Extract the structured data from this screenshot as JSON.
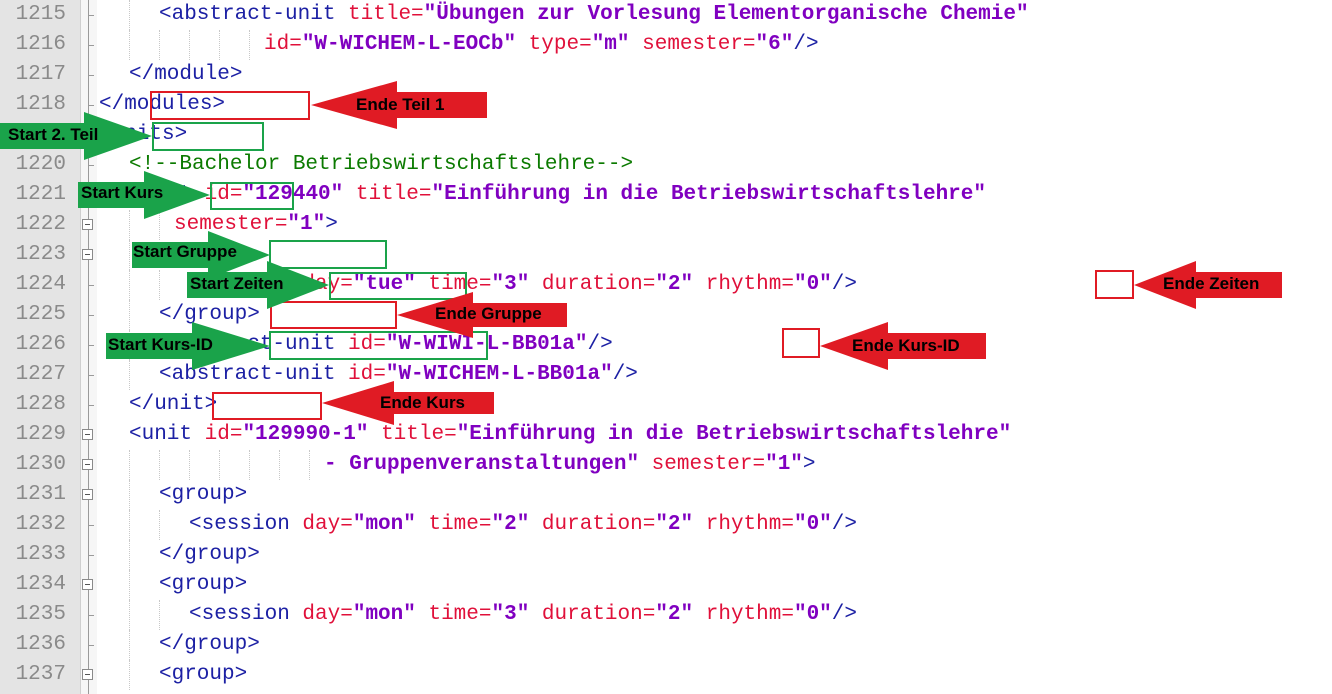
{
  "editor": {
    "lines": [
      {
        "no": "1215",
        "fold": "tick",
        "indent": 4,
        "parts": [
          [
            "t",
            "<abstract-unit "
          ],
          [
            "a",
            "title="
          ],
          [
            "v",
            "\"Übungen zur Vorlesung Elementorganische Chemie\""
          ]
        ]
      },
      {
        "no": "1216",
        "fold": "tick",
        "indent": 11,
        "parts": [
          [
            "a",
            "id="
          ],
          [
            "v",
            "\"W-WICHEM-L-EOCb\""
          ],
          [
            "t",
            " "
          ],
          [
            "a",
            "type="
          ],
          [
            "v",
            "\"m\""
          ],
          [
            "t",
            " "
          ],
          [
            "a",
            "semester="
          ],
          [
            "v",
            "\"6\""
          ],
          [
            "t",
            "/>"
          ]
        ]
      },
      {
        "no": "1217",
        "fold": "tick",
        "indent": 2,
        "parts": [
          [
            "t",
            "</module>"
          ]
        ]
      },
      {
        "no": "1218",
        "fold": "tick",
        "indent": 0,
        "parts": [
          [
            "t",
            "</modules>"
          ]
        ]
      },
      {
        "no": "1219",
        "fold": "box",
        "indent": 0,
        "parts": [
          [
            "t",
            "<units>"
          ]
        ]
      },
      {
        "no": "1220",
        "fold": "tick",
        "indent": 2,
        "parts": [
          [
            "c",
            "<!--Bachelor Betriebswirtschaftslehre-->"
          ]
        ]
      },
      {
        "no": "1221",
        "fold": "box",
        "indent": 2,
        "parts": [
          [
            "t",
            "<unit "
          ],
          [
            "a",
            "id="
          ],
          [
            "v",
            "\"129440\""
          ],
          [
            "t",
            " "
          ],
          [
            "a",
            "title="
          ],
          [
            "v",
            "\"Einführung in die Betriebswirtschaftslehre\""
          ]
        ]
      },
      {
        "no": "1222",
        "fold": "box",
        "indent": 5,
        "parts": [
          [
            "a",
            "semester="
          ],
          [
            "v",
            "\"1\""
          ],
          [
            "t",
            ">"
          ]
        ]
      },
      {
        "no": "1223",
        "fold": "box",
        "indent": 4,
        "parts": [
          [
            "t",
            "<group>"
          ]
        ]
      },
      {
        "no": "1224",
        "fold": "tick",
        "indent": 6,
        "parts": [
          [
            "t",
            "<session "
          ],
          [
            "a",
            "day="
          ],
          [
            "v",
            "\"tue\""
          ],
          [
            "t",
            " "
          ],
          [
            "a",
            "time="
          ],
          [
            "v",
            "\"3\""
          ],
          [
            "t",
            " "
          ],
          [
            "a",
            "duration="
          ],
          [
            "v",
            "\"2\""
          ],
          [
            "t",
            " "
          ],
          [
            "a",
            "rhythm="
          ],
          [
            "v",
            "\"0\""
          ],
          [
            "t",
            "/>"
          ]
        ]
      },
      {
        "no": "1225",
        "fold": "tick",
        "indent": 4,
        "parts": [
          [
            "t",
            "</group>"
          ]
        ]
      },
      {
        "no": "1226",
        "fold": "tick",
        "indent": 4,
        "parts": [
          [
            "t",
            "<abstract-unit "
          ],
          [
            "a",
            "id="
          ],
          [
            "v",
            "\"W-WIWI-L-BB01a\""
          ],
          [
            "t",
            "/>"
          ]
        ]
      },
      {
        "no": "1227",
        "fold": "tick",
        "indent": 4,
        "parts": [
          [
            "t",
            "<abstract-unit "
          ],
          [
            "a",
            "id="
          ],
          [
            "v",
            "\"W-WICHEM-L-BB01a\""
          ],
          [
            "t",
            "/>"
          ]
        ]
      },
      {
        "no": "1228",
        "fold": "tick",
        "indent": 2,
        "parts": [
          [
            "t",
            "</unit>"
          ]
        ]
      },
      {
        "no": "1229",
        "fold": "box",
        "indent": 2,
        "parts": [
          [
            "t",
            "<unit "
          ],
          [
            "a",
            "id="
          ],
          [
            "v",
            "\"129990-1\""
          ],
          [
            "t",
            " "
          ],
          [
            "a",
            "title="
          ],
          [
            "v",
            "\"Einführung in die Betriebswirtschaftslehre\""
          ]
        ]
      },
      {
        "no": "1230",
        "fold": "box",
        "indent": 15,
        "parts": [
          [
            "v",
            "- Gruppenveranstaltungen\""
          ],
          [
            "t",
            " "
          ],
          [
            "a",
            "semester="
          ],
          [
            "v",
            "\"1\""
          ],
          [
            "t",
            ">"
          ]
        ]
      },
      {
        "no": "1231",
        "fold": "box",
        "indent": 4,
        "parts": [
          [
            "t",
            "<group>"
          ]
        ]
      },
      {
        "no": "1232",
        "fold": "tick",
        "indent": 6,
        "parts": [
          [
            "t",
            "<session "
          ],
          [
            "a",
            "day="
          ],
          [
            "v",
            "\"mon\""
          ],
          [
            "t",
            " "
          ],
          [
            "a",
            "time="
          ],
          [
            "v",
            "\"2\""
          ],
          [
            "t",
            " "
          ],
          [
            "a",
            "duration="
          ],
          [
            "v",
            "\"2\""
          ],
          [
            "t",
            " "
          ],
          [
            "a",
            "rhythm="
          ],
          [
            "v",
            "\"0\""
          ],
          [
            "t",
            "/>"
          ]
        ]
      },
      {
        "no": "1233",
        "fold": "tick",
        "indent": 4,
        "parts": [
          [
            "t",
            "</group>"
          ]
        ]
      },
      {
        "no": "1234",
        "fold": "box",
        "indent": 4,
        "parts": [
          [
            "t",
            "<group>"
          ]
        ]
      },
      {
        "no": "1235",
        "fold": "tick",
        "indent": 6,
        "parts": [
          [
            "t",
            "<session "
          ],
          [
            "a",
            "day="
          ],
          [
            "v",
            "\"mon\""
          ],
          [
            "t",
            " "
          ],
          [
            "a",
            "time="
          ],
          [
            "v",
            "\"3\""
          ],
          [
            "t",
            " "
          ],
          [
            "a",
            "duration="
          ],
          [
            "v",
            "\"2\""
          ],
          [
            "t",
            " "
          ],
          [
            "a",
            "rhythm="
          ],
          [
            "v",
            "\"0\""
          ],
          [
            "t",
            "/>"
          ]
        ]
      },
      {
        "no": "1236",
        "fold": "tick",
        "indent": 4,
        "parts": [
          [
            "t",
            "</group>"
          ]
        ]
      },
      {
        "no": "1237",
        "fold": "box",
        "indent": 4,
        "parts": [
          [
            "t",
            "<group>"
          ]
        ]
      }
    ]
  },
  "annotations": {
    "ende_teil_1": "Ende Teil 1",
    "start_teil_2": "Start 2. Teil",
    "start_kurs": "Start Kurs",
    "start_gruppe": "Start Gruppe",
    "start_zeiten": "Start Zeiten",
    "ende_zeiten": "Ende Zeiten",
    "ende_gruppe": "Ende Gruppe",
    "start_kurs_id": "Start Kurs-ID",
    "ende_kurs_id": "Ende Kurs-ID",
    "ende_kurs": "Ende Kurs"
  },
  "colors": {
    "tag": "#1c20a4",
    "attribute": "#e0103a",
    "value": "#8000c0",
    "comment": "#0b7a00",
    "start_marker": "#1aa34a",
    "end_marker": "#e01b24"
  }
}
